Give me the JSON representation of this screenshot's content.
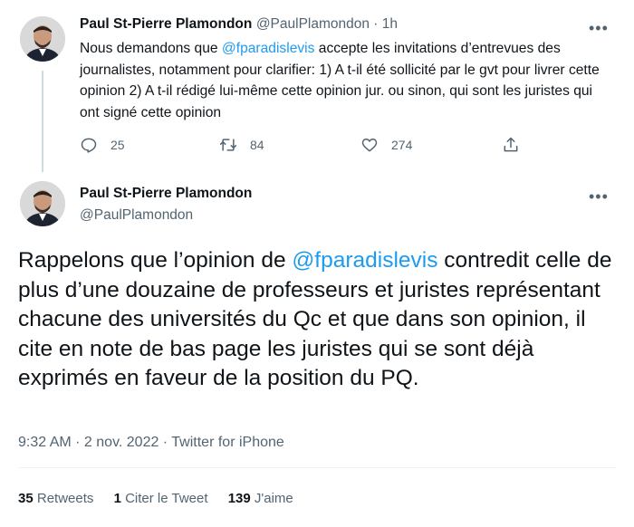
{
  "tweet1": {
    "author_name": "Paul St-Pierre Plamondon",
    "author_handle": "@PaulPlamondon",
    "time_sep": " · ",
    "time": "1h",
    "text_before": "Nous demandons que ",
    "mention": "@fparadislevis",
    "text_after": "  accepte les invitations d’entrevues des journalistes, notamment pour clarifier: 1) A t-il été sollicité par le gvt pour livrer cette opinion 2) A t-il rédigé lui-même cette opinion jur. ou sinon, qui sont les juristes qui ont signé cette opinion",
    "replies": "25",
    "retweets": "84",
    "likes": "274",
    "more": "•••"
  },
  "tweet2": {
    "author_name": "Paul St-Pierre Plamondon",
    "author_handle": "@PaulPlamondon",
    "more": "•••",
    "text_before": "Rappelons que l’opinion de ",
    "mention": "@fparadislevis",
    "text_after": " contredit celle de plus d’une douzaine de professeurs et juristes représentant chacune des universités du Qc et que dans son opinion, il cite en note de bas page les juristes qui se sont déjà exprimés en faveur de la position du PQ.",
    "meta": "9:32 AM · 2 nov. 2022 · Twitter for iPhone",
    "stats": {
      "retweets_count": "35",
      "retweets_label": "Retweets",
      "quotes_count": "1",
      "quotes_label": "Citer le Tweet",
      "likes_count": "139",
      "likes_label": "J'aime"
    }
  },
  "colors": {
    "link": "#1d9bf0",
    "muted": "#536471",
    "text": "#0f1419"
  }
}
